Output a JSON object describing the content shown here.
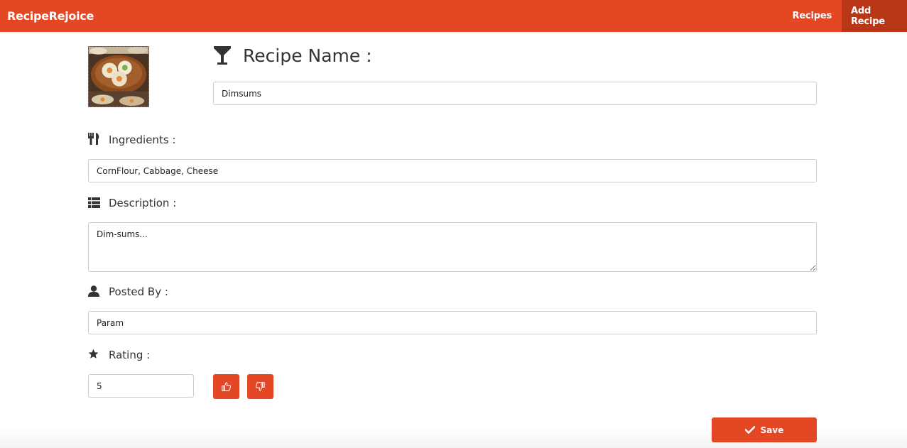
{
  "navbar": {
    "brand": "RecipeRejoice",
    "links": [
      {
        "label": "Recipes"
      },
      {
        "label": "Add Recipe"
      }
    ]
  },
  "form": {
    "recipe_name": {
      "label": "Recipe Name :",
      "value": "Dimsums",
      "icon": "cocktail-glass-icon"
    },
    "ingredients": {
      "label": "Ingredients :",
      "value": "CornFlour, Cabbage, Cheese",
      "icon": "cutlery-icon"
    },
    "description": {
      "label": "Description :",
      "value": "Dim-sums...",
      "icon": "list-icon"
    },
    "posted_by": {
      "label": "Posted By :",
      "value": "Param",
      "icon": "user-icon"
    },
    "rating": {
      "label": "Rating :",
      "value": "5",
      "icon": "star-icon"
    },
    "save_label": "Save"
  },
  "colors": {
    "accent": "#e34724",
    "accent_dark": "#b83717"
  }
}
